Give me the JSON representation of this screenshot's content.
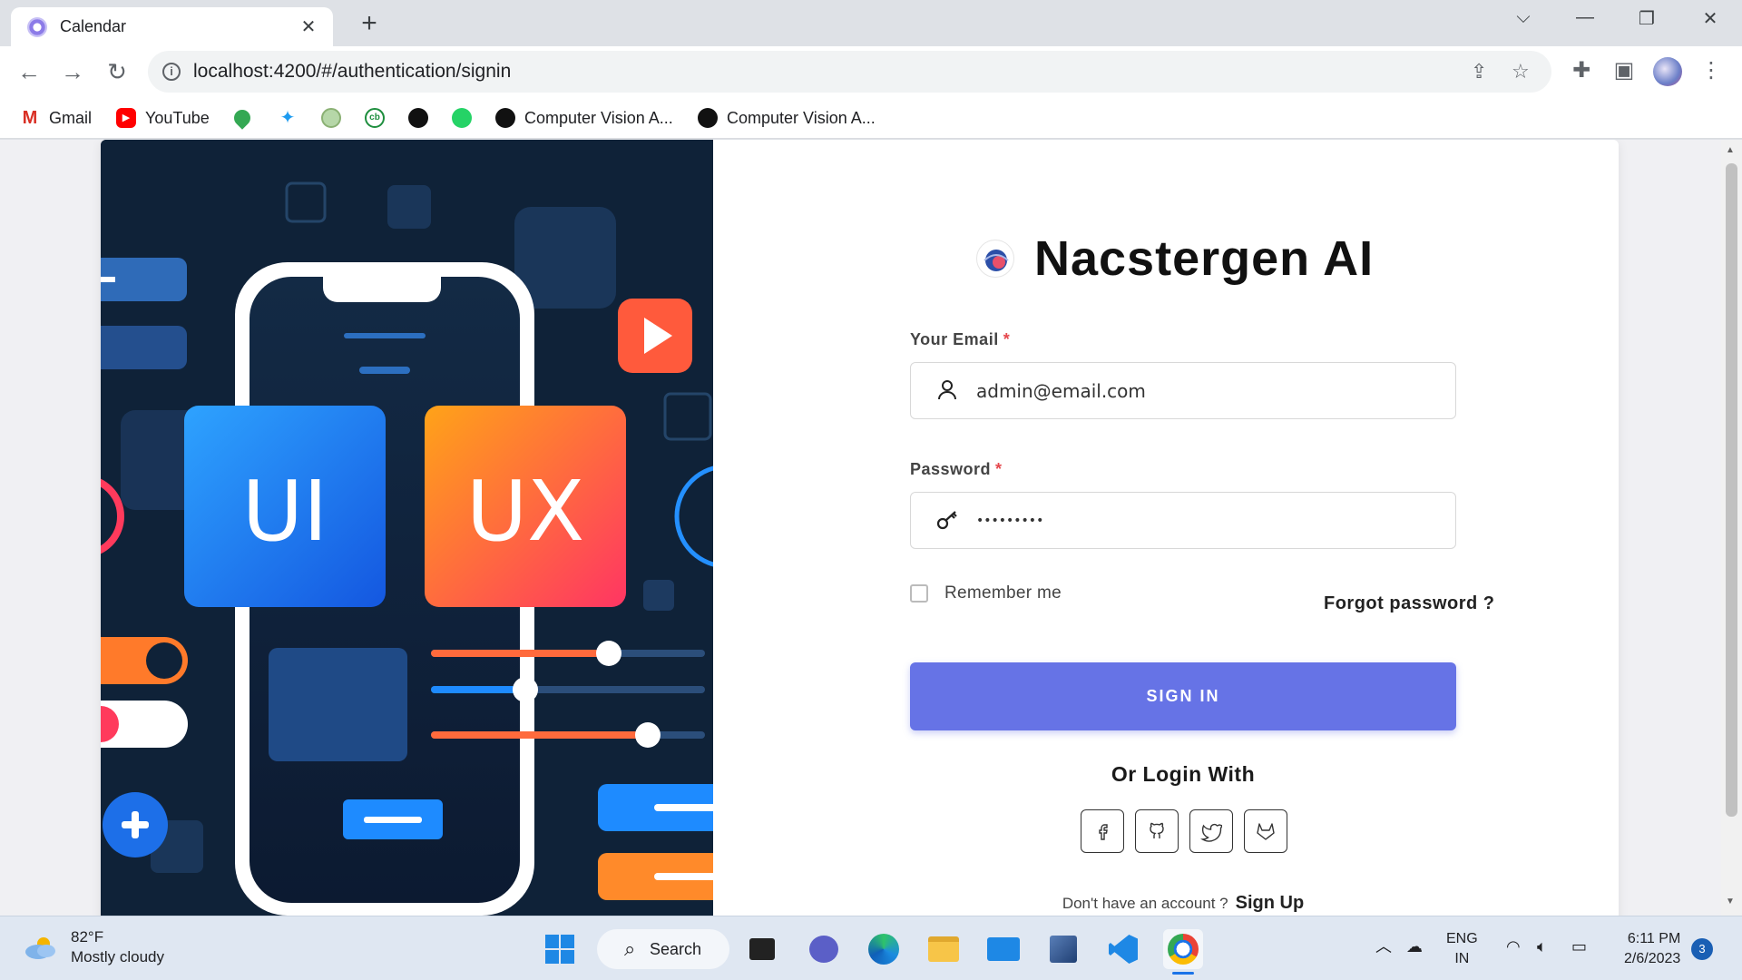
{
  "browser": {
    "tab_title": "Calendar",
    "url": "localhost:4200/#/authentication/signin",
    "bookmarks": [
      {
        "label": "Gmail",
        "icon": "gmail-icon"
      },
      {
        "label": "YouTube",
        "icon": "youtube-icon"
      },
      {
        "label": "",
        "icon": "maps-icon"
      },
      {
        "label": "",
        "icon": "twitter-icon"
      },
      {
        "label": "",
        "icon": "portal-icon"
      },
      {
        "label": "",
        "icon": "cb-icon"
      },
      {
        "label": "",
        "icon": "github-icon"
      },
      {
        "label": "",
        "icon": "whatsapp-icon"
      },
      {
        "label": "Computer Vision A...",
        "icon": "cv-icon"
      },
      {
        "label": "Computer Vision A...",
        "icon": "cv-icon"
      }
    ]
  },
  "art": {
    "ui_label": "UI",
    "ux_label": "UX"
  },
  "form": {
    "brand_title": "Nacstergen AI",
    "email_label": "Your Email",
    "required_mark": "*",
    "email_value": "admin@email.com",
    "password_label": "Password",
    "password_value": "admin@123",
    "remember_label": "Remember me",
    "forgot_label": "Forgot password ?",
    "signin_label": "SIGN IN",
    "or_login_with": "Or Login With",
    "social_providers": [
      "facebook",
      "github",
      "twitter",
      "gitlab"
    ],
    "no_account_text": "Don't have an account ?",
    "signup_label": "Sign Up"
  },
  "taskbar": {
    "temperature": "82°F",
    "weather": "Mostly cloudy",
    "search_label": "Search",
    "lang_top": "ENG",
    "lang_bottom": "IN",
    "time": "6:11 PM",
    "date": "2/6/2023",
    "notifications": "3"
  },
  "colors": {
    "primary_button": "#6673e6",
    "art_background": "#0f2238",
    "ui_tile": "#1e7bf0",
    "ux_tile": "#f56a3a"
  }
}
